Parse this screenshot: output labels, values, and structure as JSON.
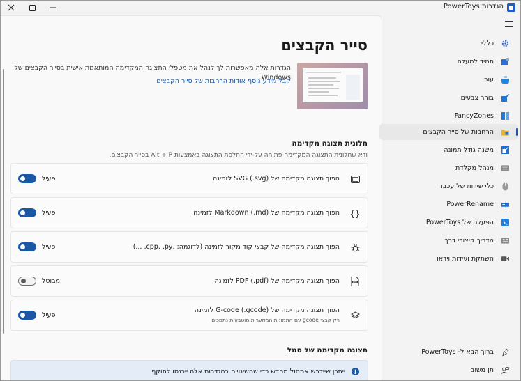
{
  "window": {
    "title": "הגדרות PowerToys"
  },
  "page": {
    "title": "סייר הקבצים",
    "description": "הגדרות אלה מאפשרות לך לנהל את מטפלי התצוגה המקדימה המותאמת אישית בסייר הקבצים של Windows.",
    "learn_more": "קבל מידע נוסף אודות הרחבות של סייר הקבצים"
  },
  "preview_section": {
    "title": "חלונית תצוגה מקדימה",
    "description": "ודא שחלונית התצוגה המקדימה פתוחה על-ידי החלפת התצוגה באמצעות Alt + P בסייר הקבצים.",
    "items": [
      {
        "label": "הפוך תצוגה מקדימה של SVG (.svg) לזמינה",
        "sublabel": "",
        "state": "פעיל",
        "icon": "image-frame-icon"
      },
      {
        "label": "הפוך תצוגה מקדימה של Markdown (.md) לזמינה",
        "sublabel": "",
        "state": "פעיל",
        "icon": "braces-icon"
      },
      {
        "label": "הפוך תצוגה מקדימה של קבצי קוד מקור לזמינה (לדוגמה: .cpp, .py, ...)",
        "sublabel": "",
        "state": "פעיל",
        "icon": "code-bug-icon"
      },
      {
        "label": "הפוך תצוגה מקדימה של PDF (.pdf) לזמינה",
        "sublabel": "",
        "state": "מבוטל",
        "icon": "pdf-icon"
      },
      {
        "label": "הפוך תצוגה מקדימה של G-code (.gcode) לזמינה",
        "sublabel": "רק קבצי gcode עם התמונות המוזערות מוטבעות נתמכים",
        "state": "פעיל",
        "icon": "layers-icon"
      }
    ]
  },
  "icon_section": {
    "title": "תצוגה מקדימה של סמל",
    "info": "ייתכן שיידרש אתחול מחדש כדי שהשינויים בהגדרות אלה ייכנסו לתוקף"
  },
  "sidebar": {
    "items": [
      {
        "label": "כללי",
        "icon": "gear-icon",
        "color": "#3b6fd4"
      },
      {
        "label": "תמיד למעלה",
        "icon": "pin-window-icon",
        "color": "#2b6fd4"
      },
      {
        "label": "עור",
        "icon": "awake-icon",
        "color": "#1f86e0"
      },
      {
        "label": "בורר צבעים",
        "icon": "color-picker-icon",
        "color": "#1f76d6"
      },
      {
        "label": "FancyZones",
        "icon": "fancyzones-icon",
        "color": "#1f7fe0"
      },
      {
        "label": "הרחבות של סייר הקבצים",
        "icon": "folder-icon",
        "color": "#e8b42a"
      },
      {
        "label": "משנה גודל תמונה",
        "icon": "image-resize-icon",
        "color": "#1f6fd4"
      },
      {
        "label": "מנהל מקלדת",
        "icon": "keyboard-icon",
        "color": "#8a8a8a"
      },
      {
        "label": "כלי שירות של עכבר",
        "icon": "mouse-icon",
        "color": "#8a8a8a"
      },
      {
        "label": "PowerRename",
        "icon": "rename-icon",
        "color": "#1f6fd4"
      },
      {
        "label": "הפעלה של PowerToys",
        "icon": "run-icon",
        "color": "#1f7fe0"
      },
      {
        "label": "מדריך קיצורי דרך",
        "icon": "shortcut-guide-icon",
        "color": "#8a8a8a"
      },
      {
        "label": "השתקת ועידות וידאו",
        "icon": "camera-icon",
        "color": "#555555"
      }
    ],
    "footer": [
      {
        "label": "ברוך הבא ל- PowerToys",
        "icon": "welcome-icon"
      },
      {
        "label": "תן משוב",
        "icon": "feedback-icon"
      }
    ]
  }
}
